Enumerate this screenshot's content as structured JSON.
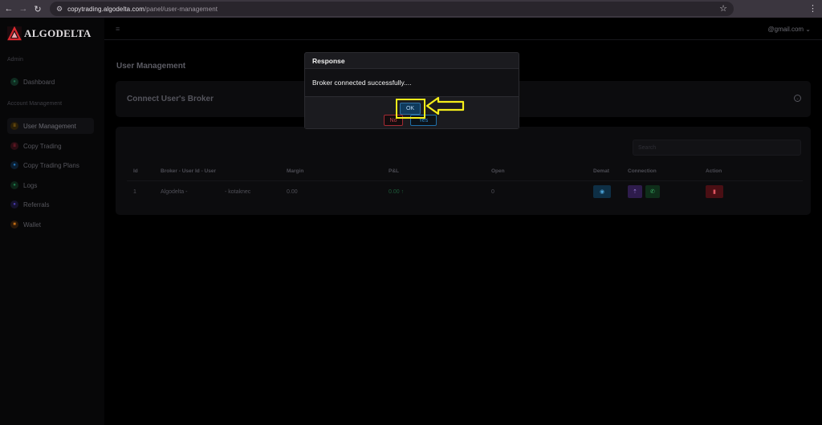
{
  "browser": {
    "url_domain": "copytrading.algodelta.com",
    "url_path": "/panel/user-management"
  },
  "brand": {
    "name": "ALGODELTA"
  },
  "sidebar": {
    "sections": [
      {
        "label": "Admin"
      },
      {
        "label": "Account Management"
      }
    ],
    "items": [
      {
        "label": "Dashboard",
        "color": "#1e6b4a"
      },
      {
        "label": "User Management",
        "color": "#c08a1a"
      },
      {
        "label": "Copy Trading",
        "color": "#b3243a"
      },
      {
        "label": "Copy Trading Plans",
        "color": "#2173b8"
      },
      {
        "label": "Logs",
        "color": "#1e7a4a"
      },
      {
        "label": "Referrals",
        "color": "#4b3ab0"
      },
      {
        "label": "Wallet",
        "color": "#c06c14"
      }
    ]
  },
  "topbar": {
    "user_email": "@gmail.com ⌄"
  },
  "page": {
    "title": "User Management",
    "connect_title": "Connect User's Broker",
    "search_placeholder": "Search"
  },
  "table": {
    "headers": [
      "Id",
      "Broker - User Id - User",
      "Margin",
      "P&L",
      "Open",
      "Demat",
      "Connection",
      "Action"
    ],
    "rows": [
      {
        "id": "1",
        "broker": "Algodelta -",
        "user": "- kotaknec",
        "margin": "0.00",
        "pnl": "0.00 ↑",
        "open": "0"
      }
    ]
  },
  "modal": {
    "title": "Response",
    "message": "Broker connected successfully....",
    "ok_label": "OK",
    "no_label": "No",
    "yes_label": "Yes"
  },
  "colors": {
    "highlight": "#f5ee1a",
    "demat_button": "#1a6fa3",
    "connection_button_1": "#6c3fb0",
    "connection_button_2": "#1d7a3e",
    "delete_button": "#b3232f"
  }
}
